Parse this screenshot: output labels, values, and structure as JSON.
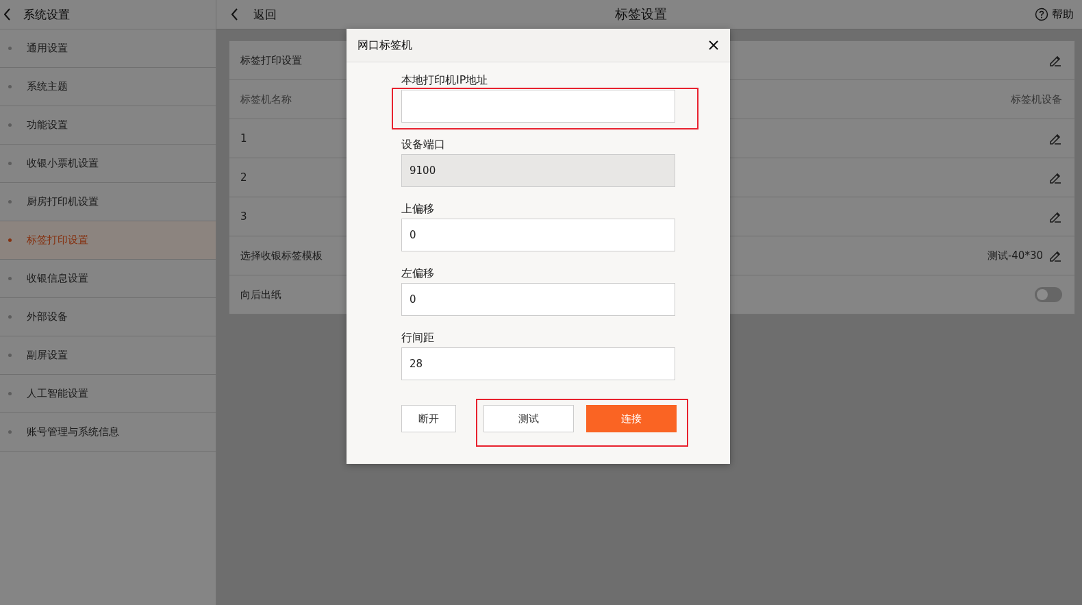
{
  "sidebar": {
    "back_title": "系统设置",
    "items": [
      {
        "label": "通用设置",
        "selected": false
      },
      {
        "label": "系统主题",
        "selected": false
      },
      {
        "label": "功能设置",
        "selected": false
      },
      {
        "label": "收银小票机设置",
        "selected": false
      },
      {
        "label": "厨房打印机设置",
        "selected": false
      },
      {
        "label": "标签打印设置",
        "selected": true
      },
      {
        "label": "收银信息设置",
        "selected": false
      },
      {
        "label": "外部设备",
        "selected": false
      },
      {
        "label": "副屏设置",
        "selected": false
      },
      {
        "label": "人工智能设置",
        "selected": false
      },
      {
        "label": "账号管理与系统信息",
        "selected": false
      }
    ]
  },
  "header": {
    "back": "返回",
    "title": "标签设置",
    "help": "帮助"
  },
  "settings": {
    "rows": [
      {
        "kind": "edit",
        "label": "标签打印设置"
      },
      {
        "kind": "heading",
        "label": "标签机名称",
        "value": "标签机设备"
      },
      {
        "kind": "edit",
        "label": "1"
      },
      {
        "kind": "edit",
        "label": "2"
      },
      {
        "kind": "edit",
        "label": "3"
      },
      {
        "kind": "edit",
        "label": "选择收银标签模板",
        "value": "测试-40*30"
      },
      {
        "kind": "toggle",
        "label": "向后出纸",
        "on": false
      }
    ]
  },
  "dialog": {
    "title": "网口标签机",
    "fields": [
      {
        "label": "本地打印机IP地址",
        "disabled": false,
        "highlighted": true
      },
      {
        "label": "设备端口",
        "value": "9100",
        "disabled": true,
        "highlighted": false
      },
      {
        "label": "上偏移",
        "value": "0",
        "disabled": false,
        "highlighted": false
      },
      {
        "label": "左偏移",
        "value": "0",
        "disabled": false,
        "highlighted": false
      },
      {
        "label": "行间距",
        "value": "28",
        "disabled": false,
        "highlighted": false
      }
    ],
    "button_groups": [
      {
        "highlighted": false,
        "buttons": [
          {
            "label": "断开",
            "kind": "outline"
          }
        ]
      },
      {
        "highlighted": true,
        "buttons": [
          {
            "label": "测试",
            "kind": "outline"
          },
          {
            "label": "连接",
            "kind": "primary"
          }
        ]
      }
    ]
  }
}
